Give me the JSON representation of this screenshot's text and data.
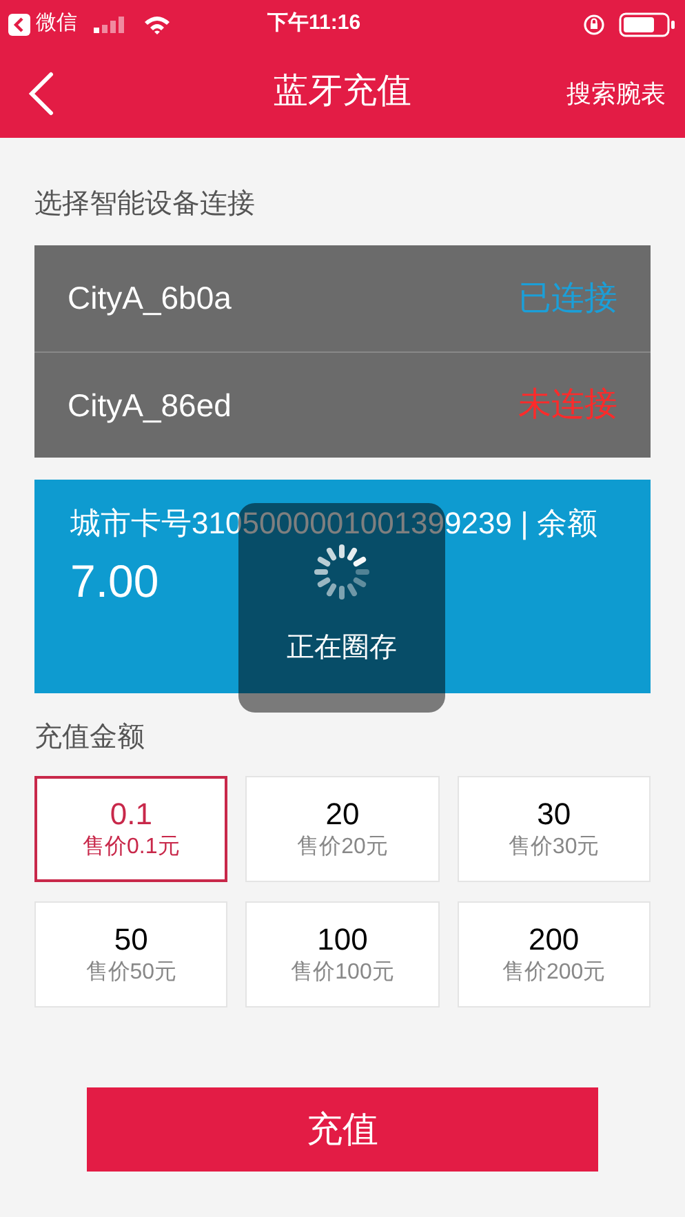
{
  "status_bar": {
    "back_app": "微信",
    "time": "下午11:16"
  },
  "nav": {
    "title": "蓝牙充值",
    "action": "搜索腕表"
  },
  "device_section": {
    "title": "选择智能设备连接"
  },
  "devices": [
    {
      "name": "CityA_6b0a",
      "status": "已连接",
      "connected": true
    },
    {
      "name": "CityA_86ed",
      "status": "未连接",
      "connected": false
    }
  ],
  "card": {
    "info": "城市卡号3105000001001399239 | 余额",
    "balance": "7.00"
  },
  "loading": {
    "text": "正在圈存"
  },
  "amount_section": {
    "title": "充值金额"
  },
  "amounts": [
    {
      "value": "0.1",
      "price": "售价0.1元",
      "selected": true
    },
    {
      "value": "20",
      "price": "售价20元",
      "selected": false
    },
    {
      "value": "30",
      "price": "售价30元",
      "selected": false
    },
    {
      "value": "50",
      "price": "售价50元",
      "selected": false
    },
    {
      "value": "100",
      "price": "售价100元",
      "selected": false
    },
    {
      "value": "200",
      "price": "售价200元",
      "selected": false
    }
  ],
  "submit": "充值"
}
